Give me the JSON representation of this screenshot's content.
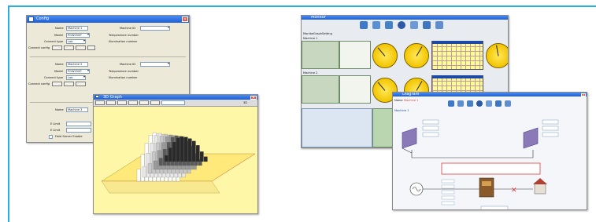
{
  "config_window": {
    "title": "Config",
    "sections": [
      {
        "name_label": "Name",
        "name_value": "Machine 1",
        "model_label": "Model",
        "model_value": "PGW250P",
        "connect_type_label": "Connect type",
        "connect_type_value": "Lab",
        "connect_config_label": "Connect config",
        "machine_id_label": "Machine ID",
        "temperature_label": "Temperature number",
        "illumination_label": "Illumination number"
      },
      {
        "name_label": "Name",
        "name_value": "Machine 2",
        "model_label": "Model",
        "model_value": "PGW250P",
        "connect_type_label": "Connect type",
        "connect_type_value": "Lab",
        "connect_config_label": "Connect config",
        "machine_id_label": "Machine ID",
        "temperature_label": "Temperature number",
        "illumination_label": "Illumination number"
      },
      {
        "name_label": "Name",
        "name_value": "Machine 3",
        "e_limit1_label": "E Limit",
        "e_limit2_label": "E Limit",
        "checkbox_label": "Field Server Enable"
      }
    ]
  },
  "chart_window": {
    "title": "3D Graph",
    "toolbar_buttons": [
      "",
      "",
      "",
      "",
      "",
      ""
    ],
    "readout": "",
    "corner_text": "3D"
  },
  "monitor_window": {
    "title": "Monitor",
    "tabs": [
      "Monitor",
      "Graph",
      "Setting"
    ],
    "rows": [
      {
        "row_label": "Machine 1",
        "values": [
          "",
          "",
          "",
          ""
        ]
      },
      {
        "row_label": "Machine 2",
        "values": [
          "",
          "",
          "",
          ""
        ]
      }
    ],
    "icons": [
      "monitor-icon",
      "tool-icon",
      "wrench-icon",
      "globe-icon",
      "help-icon",
      "chart-icon",
      "document-icon"
    ]
  },
  "diagram_window": {
    "title": "Diagram",
    "header_left": "Name",
    "header_value": "Machine 1",
    "machine_label": "Machine 1",
    "icons": [
      "monitor-icon",
      "tool-icon",
      "wrench-icon",
      "globe-icon",
      "help-icon",
      "chart-icon",
      "document-icon"
    ]
  },
  "colors": {
    "frame": "#29aee0",
    "titlebar": "#1c5ed8",
    "gauge": "#f3c400",
    "plot_bg": "#fffb9a",
    "status_red": "#e23b3b"
  }
}
